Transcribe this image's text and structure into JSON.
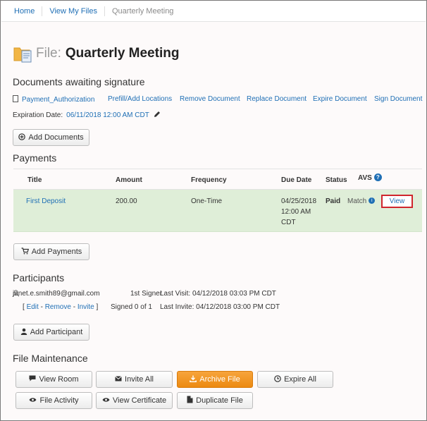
{
  "breadcrumb": [
    "Home",
    "View My Files",
    "Quarterly Meeting"
  ],
  "title": {
    "prefix": "File:",
    "name": "Quarterly Meeting"
  },
  "documents": {
    "heading": "Documents awaiting signature",
    "doc_name": "Payment_Authorization",
    "actions": [
      "Prefill/Add Locations",
      "Remove Document",
      "Replace Document",
      "Expire Document",
      "Sign Document"
    ],
    "expiration_label": "Expiration Date:",
    "expiration_value": "06/11/2018 12:00 AM CDT",
    "add_button": "Add Documents"
  },
  "payments": {
    "heading": "Payments",
    "columns": [
      "Title",
      "Amount",
      "Frequency",
      "Due Date",
      "Status",
      "AVS"
    ],
    "row": {
      "title": "First Deposit",
      "amount": "200.00",
      "frequency": "One-Time",
      "due_line1": "04/25/2018",
      "due_line2": "12:00 AM",
      "due_line3": "CDT",
      "status": "Paid",
      "avs": "Match",
      "view": "View"
    },
    "add_button": "Add Payments"
  },
  "participants": {
    "heading": "Participants",
    "email": "janet.e.smith89@gmail.com",
    "role": "1st Signer",
    "last_visit": "Last Visit: 04/12/2018 03:03 PM CDT",
    "edit": "Edit",
    "remove": "Remove",
    "invite": "Invite",
    "signed": "Signed 0 of 1",
    "last_invite": "Last Invite: 04/12/2018 03:00 PM CDT",
    "add_button": "Add Participant"
  },
  "maintenance": {
    "heading": "File Maintenance",
    "view_room": "View Room",
    "invite_all": "Invite All",
    "archive_file": "Archive File",
    "expire_all": "Expire All",
    "file_activity": "File Activity",
    "view_certificate": "View Certificate",
    "duplicate_file": "Duplicate File"
  },
  "colors": {
    "link": "#1f6fb5",
    "paid_row": "#dfeed8",
    "archive": "#ec8a11",
    "highlight": "#d0262d"
  }
}
